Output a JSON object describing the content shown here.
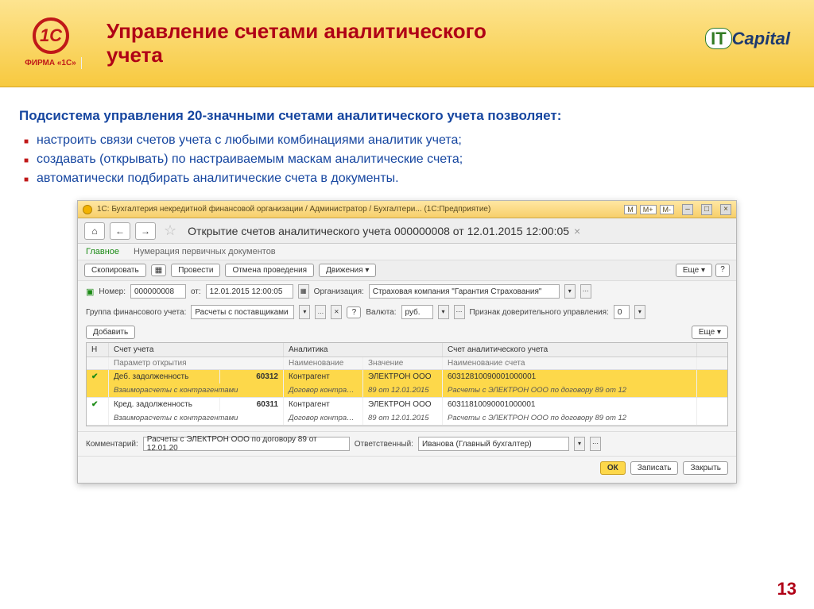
{
  "slide": {
    "logo_sub": "ФИРМА «1С»",
    "title": "Управление счетами аналитического учета",
    "brand_it": "IT",
    "brand_cap": "Capital",
    "page_number": "13"
  },
  "text": {
    "intro": "Подсистема управления 20-значными счетами аналитического учета позволяет:",
    "bullets": [
      "настроить связи счетов учета с любыми комбинациями аналитик учета;",
      "создавать (открывать) по настраиваемым маскам аналитические счета;",
      "автоматически подбирать аналитические счета в документы."
    ]
  },
  "win": {
    "title": "1С: Бухгалтерия некредитной финансовой организации / Администратор / Бухгалтери... (1С:Предприятие)",
    "mem": [
      "M",
      "M+",
      "M-"
    ],
    "doc_title": "Открытие счетов аналитического учета 000000008 от 12.01.2015 12:00:05",
    "tab_main": "Главное",
    "tab_num": "Нумерация первичных документов",
    "btn_copy": "Скопировать",
    "btn_post": "Провести",
    "btn_unpost": "Отмена проведения",
    "btn_moves": "Движения",
    "btn_more": "Еще",
    "btn_q": "?",
    "lbl_number": "Номер:",
    "val_number": "000000008",
    "lbl_from": "от:",
    "val_date": "12.01.2015 12:00:05",
    "lbl_org": "Организация:",
    "val_org": "Страховая компания \"Гарантия Страхования\"",
    "lbl_group": "Группа финансового учета:",
    "val_group": "Расчеты с поставщиками",
    "lbl_currency": "Валюта:",
    "val_currency": "руб.",
    "lbl_trust": "Признак доверительного управления:",
    "val_trust": "0",
    "btn_add": "Добавить",
    "th_n": "Н",
    "th_account": "Счет учета",
    "th_analytics": "Аналитика",
    "th_analacc": "Счет аналитического учета",
    "sub_param": "Параметр открытия",
    "sub_name": "Наименование",
    "sub_value": "Значение",
    "sub_accname": "Наименование счета",
    "rows": [
      {
        "type": "Деб. задолженность",
        "code": "60312",
        "an_name": "Контрагент",
        "an_val": "ЭЛЕКТРОН ООО",
        "acc": "60312810090001000001",
        "group": "Взаиморасчеты с контрагентами",
        "sub_name": "Договор контрагента",
        "sub_val": "89 от 12.01.2015",
        "acc_name": "Расчеты с ЭЛЕКТРОН ООО по договору 89 от 12"
      },
      {
        "type": "Кред. задолженность",
        "code": "60311",
        "an_name": "Контрагент",
        "an_val": "ЭЛЕКТРОН ООО",
        "acc": "60311810090001000001",
        "group": "Взаиморасчеты с контрагентами",
        "sub_name": "Договор контрагента",
        "sub_val": "89 от 12.01.2015",
        "acc_name": "Расчеты с ЭЛЕКТРОН ООО по договору 89 от 12"
      }
    ],
    "lbl_comment": "Комментарий:",
    "val_comment": "Расчеты с ЭЛЕКТРОН ООО по договору 89 от 12.01.20",
    "lbl_resp": "Ответственный:",
    "val_resp": "Иванова (Главный бухгалтер)",
    "btn_ok": "ОК",
    "btn_save": "Записать",
    "btn_close": "Закрыть"
  }
}
